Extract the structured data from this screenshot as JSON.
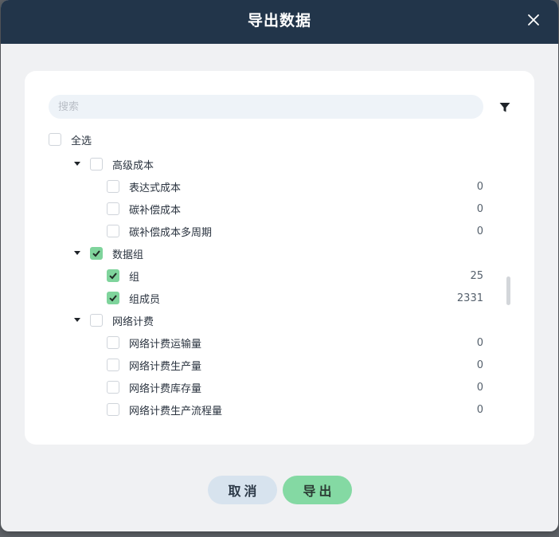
{
  "dialog": {
    "title": "导出数据"
  },
  "search": {
    "placeholder": "搜索"
  },
  "tree": {
    "select_all": {
      "label": "全选",
      "checked": false
    },
    "groups": [
      {
        "label": "高级成本",
        "checked": false,
        "children": [
          {
            "label": "表达式成本",
            "count": "0",
            "checked": false
          },
          {
            "label": "碳补偿成本",
            "count": "0",
            "checked": false
          },
          {
            "label": "碳补偿成本多周期",
            "count": "0",
            "checked": false
          }
        ]
      },
      {
        "label": "数据组",
        "checked": true,
        "children": [
          {
            "label": "组",
            "count": "25",
            "checked": true
          },
          {
            "label": "组成员",
            "count": "2331",
            "checked": true
          }
        ]
      },
      {
        "label": "网络计费",
        "checked": false,
        "children": [
          {
            "label": "网络计费运输量",
            "count": "0",
            "checked": false
          },
          {
            "label": "网络计费生产量",
            "count": "0",
            "checked": false
          },
          {
            "label": "网络计费库存量",
            "count": "0",
            "checked": false
          },
          {
            "label": "网络计费生产流程量",
            "count": "0",
            "checked": false
          }
        ]
      }
    ]
  },
  "footer": {
    "cancel_label": "取消",
    "export_label": "导出"
  },
  "colors": {
    "header": "#22354a",
    "check_accent": "#7fd49c",
    "export_button": "#84d9a3",
    "cancel_button": "#d7e3ee"
  },
  "icons": {
    "close": "close-icon",
    "filter": "filter-icon",
    "caret": "caret-down-icon",
    "check": "check-icon"
  }
}
